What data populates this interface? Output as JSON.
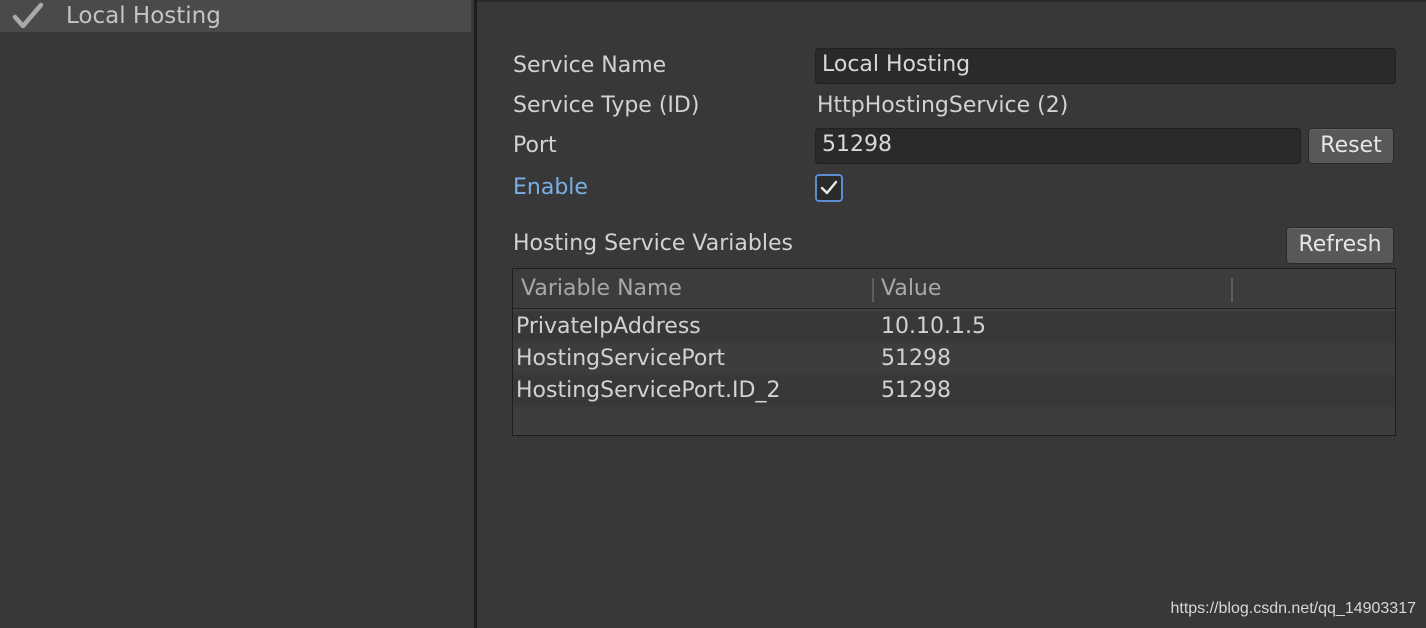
{
  "sidebar": {
    "items": [
      {
        "label": "Local Hosting",
        "icon": "checkmark-icon",
        "selected": true
      }
    ]
  },
  "inspector": {
    "service_name_label": "Service Name",
    "service_name_value": "Local Hosting",
    "service_type_label": "Service Type (ID)",
    "service_type_value": "HttpHostingService (2)",
    "port_label": "Port",
    "port_value": "51298",
    "reset_label": "Reset",
    "enable_label": "Enable",
    "enable_checked": true,
    "variables_title": "Hosting Service Variables",
    "refresh_label": "Refresh"
  },
  "variables_table": {
    "columns": [
      "Variable Name",
      "Value"
    ],
    "rows": [
      {
        "name": "PrivateIpAddress",
        "value": "10.10.1.5"
      },
      {
        "name": "HostingServicePort",
        "value": "51298"
      },
      {
        "name": "HostingServicePort.ID_2",
        "value": "51298"
      }
    ]
  },
  "watermark": "https://blog.csdn.net/qq_14903317",
  "colors": {
    "background": "#383838",
    "selected_item": "#4a4a4a",
    "accent_blue": "#7aaee8",
    "checkbox_border": "#5a8ed0"
  }
}
